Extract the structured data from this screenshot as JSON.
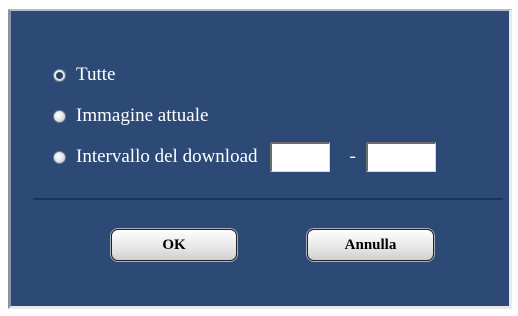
{
  "options": [
    {
      "label": "Tutte",
      "checked": true
    },
    {
      "label": "Immagine attuale",
      "checked": false
    },
    {
      "label": "Intervallo del download",
      "checked": false
    }
  ],
  "range": {
    "from_value": "",
    "separator": "-",
    "to_value": ""
  },
  "buttons": {
    "ok_label": "OK",
    "cancel_label": "Annulla"
  },
  "colors": {
    "panel_background": "#2d4a76",
    "text": "#ffffff"
  }
}
